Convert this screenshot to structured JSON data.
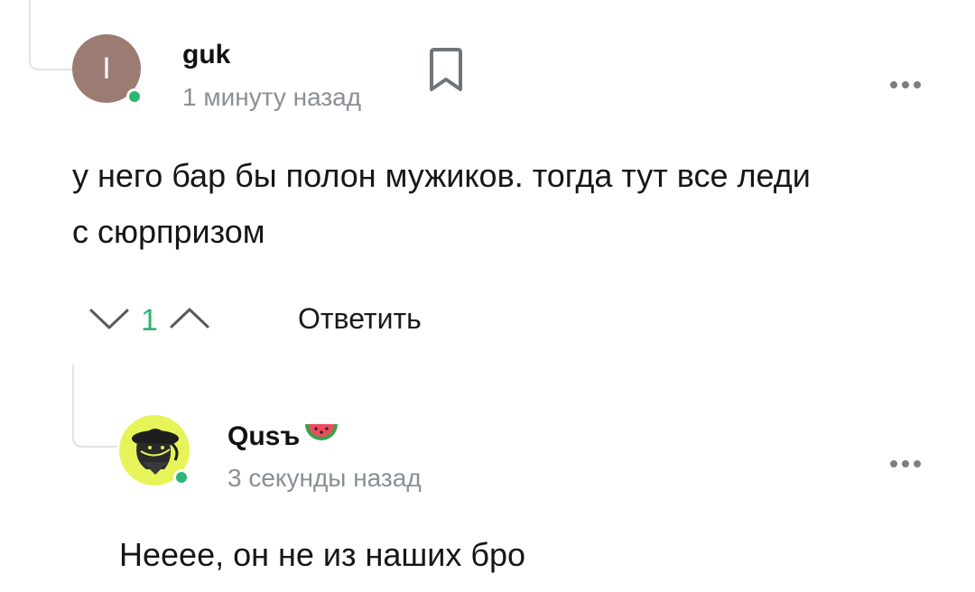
{
  "comment1": {
    "avatar_letter": "I",
    "avatar_color": "#9b7b72",
    "author": "guk",
    "time": "1 минуту назад",
    "bookmark_icon": "bookmark-icon",
    "more_icon": "more-icon",
    "text_line1": "у него бар бы полон мужиков. тогда тут все леди",
    "text_line2": "с сюрпризом",
    "score": "1",
    "reply_label": "Ответить"
  },
  "comment2": {
    "avatar_color": "#e6f45a",
    "author": "Qusъ",
    "badge_icon": "watermelon-icon",
    "time": "3 секунды назад",
    "more_icon": "more-icon",
    "text": "Нееее, он не из наших бро"
  },
  "colors": {
    "online": "#2bb673",
    "accent": "#2bb673",
    "muted": "#8a8f94"
  }
}
